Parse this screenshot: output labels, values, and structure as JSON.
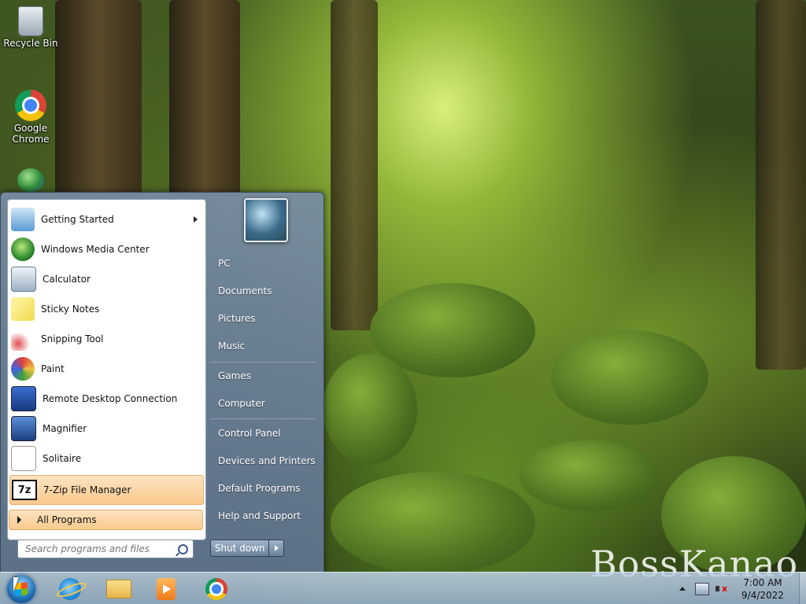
{
  "desktop": {
    "icons": [
      {
        "label": "Recycle Bin",
        "icon": "recycle-bin-icon"
      },
      {
        "label": "Google Chrome",
        "icon": "chrome-icon"
      },
      {
        "label": "",
        "icon": "globe-icon"
      }
    ],
    "watermark": "BossKanao"
  },
  "start_menu": {
    "programs": [
      {
        "label": "Getting Started",
        "icon": "getting-started-icon",
        "has_submenu": true
      },
      {
        "label": "Windows Media Center",
        "icon": "media-center-icon"
      },
      {
        "label": "Calculator",
        "icon": "calculator-icon"
      },
      {
        "label": "Sticky Notes",
        "icon": "sticky-notes-icon"
      },
      {
        "label": "Snipping Tool",
        "icon": "scissors-icon"
      },
      {
        "label": "Paint",
        "icon": "paint-palette-icon"
      },
      {
        "label": "Remote Desktop Connection",
        "icon": "remote-desktop-icon"
      },
      {
        "label": "Magnifier",
        "icon": "magnifier-icon"
      },
      {
        "label": "Solitaire",
        "icon": "solitaire-icon"
      },
      {
        "label": "7-Zip File Manager",
        "icon": "7zip-icon",
        "highlighted": true
      }
    ],
    "all_programs": "All Programs",
    "search_placeholder": "Search programs and files",
    "right_links": [
      {
        "label": "PC"
      },
      {
        "label": "Documents"
      },
      {
        "label": "Pictures"
      },
      {
        "label": "Music"
      },
      {
        "label": "Games"
      },
      {
        "label": "Computer"
      },
      {
        "label": "Control Panel"
      },
      {
        "label": "Devices and Printers"
      },
      {
        "label": "Default Programs"
      },
      {
        "label": "Help and Support"
      }
    ],
    "shutdown_label": "Shut down"
  },
  "taskbar": {
    "pinned": [
      "internet-explorer-icon",
      "folder-icon",
      "media-player-icon",
      "chrome-icon"
    ],
    "clock_time": "7:00 AM",
    "clock_date": "9/4/2022"
  },
  "colors": {
    "highlight": "#f9c98d",
    "menu_right": "#6b829b"
  }
}
